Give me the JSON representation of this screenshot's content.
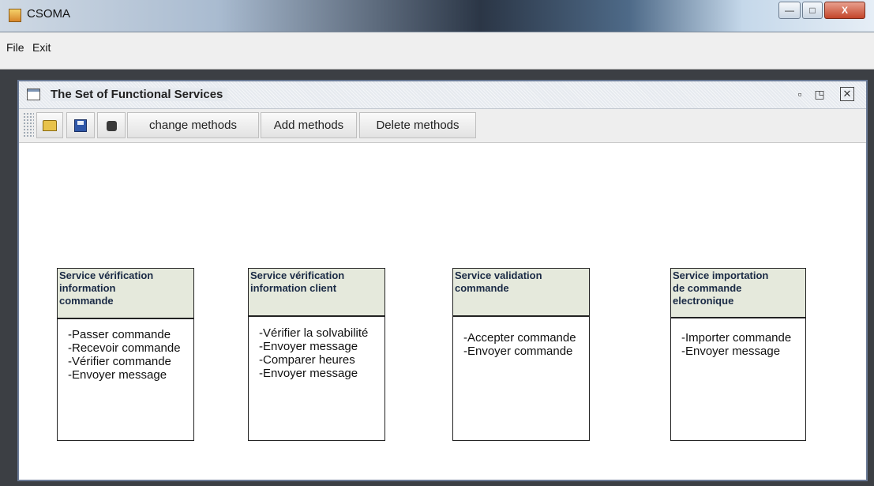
{
  "window": {
    "title": "CSOMA",
    "controls": {
      "minimize": "—",
      "maximize": "□",
      "close": "X"
    }
  },
  "menu": {
    "file": "File",
    "exit": "Exit"
  },
  "internal_frame": {
    "title": "The Set of Functional Services",
    "controls": {
      "iconify": "▫",
      "maximize": "◳",
      "close": "✕"
    }
  },
  "toolbar": {
    "change_label": "change methods",
    "add_label": "Add methods",
    "delete_label": "Delete methods"
  },
  "services": [
    {
      "title_lines": [
        "Service vérification",
        "information",
        "commande"
      ],
      "methods": [
        "-Passer commande",
        "-Recevoir commande",
        "-Vérifier commande",
        "-Envoyer message"
      ]
    },
    {
      "title_lines": [
        "Service vérification",
        "information client"
      ],
      "methods": [
        "-Vérifier la solvabilité",
        "-Envoyer message",
        "-Comparer heures",
        "-Envoyer message"
      ]
    },
    {
      "title_lines": [
        "Service validation",
        "commande"
      ],
      "methods": [
        "-Accepter commande",
        "-Envoyer commande"
      ]
    },
    {
      "title_lines": [
        "Service importation",
        "de commande",
        "electronique"
      ],
      "methods": [
        "-Importer commande",
        "-Envoyer message"
      ]
    }
  ]
}
